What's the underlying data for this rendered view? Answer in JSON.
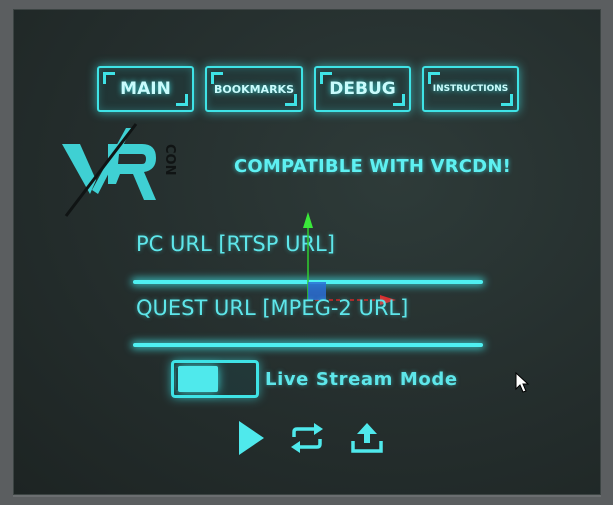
{
  "nav": {
    "main": "MAIN",
    "bookmarks": "BOOKMARKS",
    "debug": "DEBUG",
    "instructions": "INSTRUCTIONS"
  },
  "logo": {
    "text": "VR",
    "subtext": "CON"
  },
  "compat_text": "COMPATIBLE WITH VRCDN!",
  "fields": {
    "pc_label": "PC URL [RTSP URL]",
    "quest_label": "QUEST URL [MPEG-2 URL]",
    "pc_value": "",
    "quest_value": ""
  },
  "toggle": {
    "label": "Live Stream Mode",
    "state": "on"
  },
  "controls": {
    "play": "play-icon",
    "loop": "loop-icon",
    "upload": "upload-icon"
  },
  "colors": {
    "accent": "#3fe3e6",
    "panel_bg": "#26302f"
  }
}
